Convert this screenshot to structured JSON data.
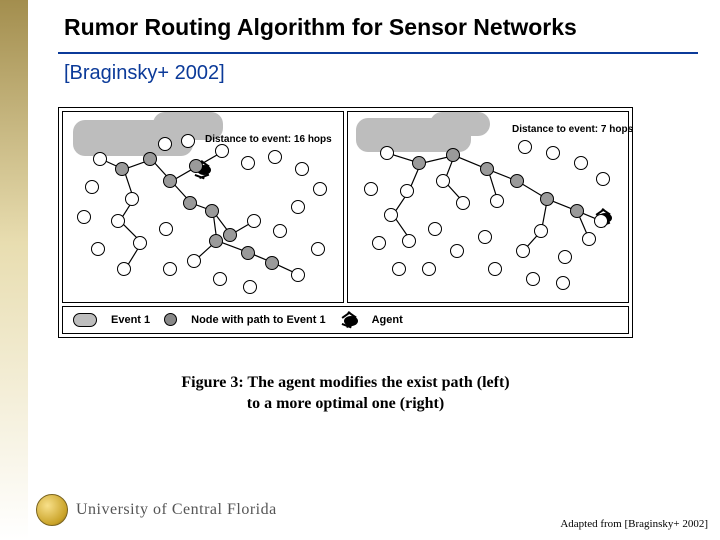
{
  "title": "Rumor Routing Algorithm for Sensor Networks",
  "citation": "[Braginsky+ 2002]",
  "figure": {
    "left_label": "Distance to event: 16 hops",
    "right_label": "Distance to event: 7 hops",
    "legend": {
      "event": "Event 1",
      "node_path": "Node with path to Event 1",
      "agent": "Agent"
    },
    "caption_line1": "Figure 3: The agent modifies the exist path (left)",
    "caption_line2": "to a more optimal one (right)"
  },
  "footer": {
    "university": "University of Central Florida",
    "attribution": "Adapted from [Braginsky+ 2002]"
  }
}
